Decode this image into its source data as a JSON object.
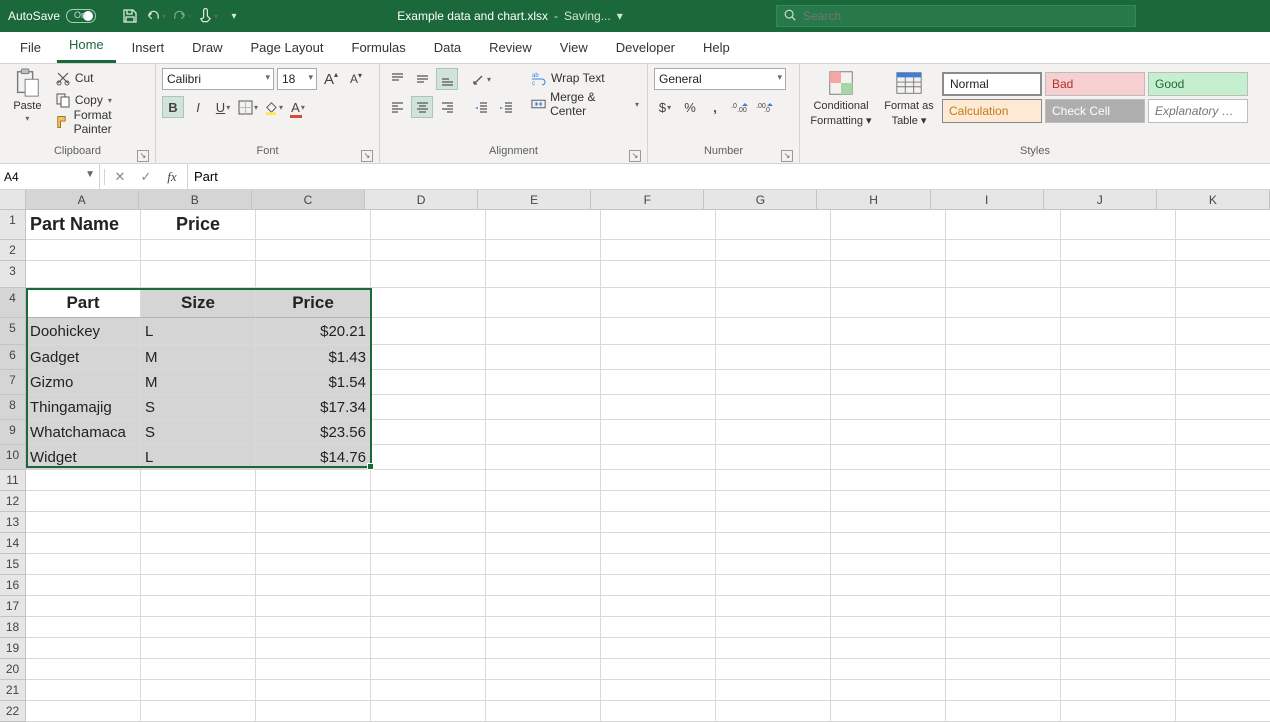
{
  "title": {
    "autosave": "AutoSave",
    "autosave_state": "On",
    "file": "Example data and chart.xlsx",
    "sep": "-",
    "status": "Saving...",
    "dd": "▾"
  },
  "search": {
    "placeholder": "Search"
  },
  "tabs": [
    "File",
    "Home",
    "Insert",
    "Draw",
    "Page Layout",
    "Formulas",
    "Data",
    "Review",
    "View",
    "Developer",
    "Help"
  ],
  "active_tab": "Home",
  "ribbon": {
    "clipboard": {
      "label": "Clipboard",
      "paste": "Paste",
      "cut": "Cut",
      "copy": "Copy",
      "format_painter": "Format Painter"
    },
    "font": {
      "label": "Font",
      "font_name": "Calibri",
      "font_size": "18",
      "inc": "A",
      "dec": "A"
    },
    "alignment": {
      "label": "Alignment",
      "wrap": "Wrap Text",
      "merge": "Merge & Center"
    },
    "number": {
      "label": "Number",
      "format": "General"
    },
    "styles": {
      "label": "Styles",
      "conditional_l1": "Conditional",
      "conditional_l2": "Formatting",
      "table_l1": "Format as",
      "table_l2": "Table",
      "cells": {
        "normal": "Normal",
        "bad": "Bad",
        "good": "Good",
        "calc": "Calculation",
        "check": "Check Cell",
        "explan": "Explanatory …"
      }
    }
  },
  "namebox": "A4",
  "formula": "Part",
  "columns": [
    "A",
    "B",
    "C",
    "D",
    "E",
    "F",
    "G",
    "H",
    "I",
    "J",
    "K"
  ],
  "rows": [
    1,
    2,
    3,
    4,
    5,
    6,
    7,
    8,
    9,
    10,
    11,
    12,
    13,
    14,
    15,
    16,
    17,
    18,
    19,
    20,
    21,
    22
  ],
  "sheet": {
    "hdr1": {
      "A": "Part Name",
      "B": "Price"
    },
    "thdr": {
      "A": "Part",
      "B": "Size",
      "C": "Price"
    },
    "data": [
      {
        "part": "Doohickey",
        "size": "L",
        "price": "$20.21"
      },
      {
        "part": "Gadget",
        "size": "M",
        "price": "$1.43"
      },
      {
        "part": "Gizmo",
        "size": "M",
        "price": "$1.54"
      },
      {
        "part": "Thingamajig",
        "size": "S",
        "price": "$17.34"
      },
      {
        "part": "Whatchamaca",
        "size": "S",
        "price": "$23.56"
      },
      {
        "part": "Widget",
        "size": "L",
        "price": "$14.76"
      }
    ]
  },
  "selection": {
    "range": "A4:C10",
    "active": "A4"
  }
}
